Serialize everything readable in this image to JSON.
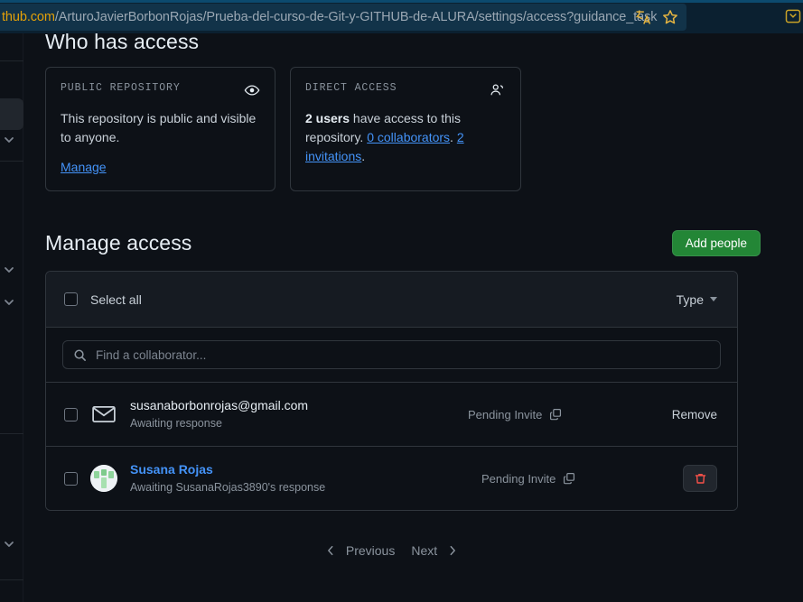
{
  "browser": {
    "url_host": "thub.com",
    "url_path": "/ArturoJavierBorbonRojas/Prueba-del-curso-de-Git-y-GITHUB-de-ALURA/settings/access?guidance_task",
    "translate_icon": "translate-icon",
    "star_icon": "star-icon",
    "edge_icon": "collections-icon"
  },
  "page": {
    "who_has_access_title": "Who has access",
    "manage_access_title": "Manage access"
  },
  "cards": {
    "public": {
      "label": "PUBLIC REPOSITORY",
      "icon": "eye-icon",
      "body": "This repository is public and visible to anyone.",
      "manage_link": "Manage"
    },
    "direct": {
      "label": "DIRECT ACCESS",
      "icon": "people-icon",
      "count": "2 users",
      "body_1": " have access to this repository. ",
      "link_collaborators": "0 collaborators",
      "sep": ". ",
      "link_invitations": "2 invitations",
      "period": "."
    }
  },
  "toolbar": {
    "add_people_label": "Add people",
    "add_people_color": "#238636"
  },
  "access_table": {
    "select_all_label": "Select all",
    "type_label": "Type",
    "search_placeholder": "Find a collaborator...",
    "search_value": "",
    "search_icon": "search-icon",
    "rows": [
      {
        "avatar_type": "mail",
        "name": "susanaborbonrojas@gmail.com",
        "name_is_link": false,
        "sub": "Awaiting response",
        "status": "Pending Invite",
        "action": "Remove",
        "action_type": "text"
      },
      {
        "avatar_type": "image",
        "name": "Susana Rojas",
        "name_is_link": true,
        "sub": "Awaiting SusanaRojas3890's response",
        "status": "Pending Invite",
        "action": "trash-icon",
        "action_type": "button"
      }
    ]
  },
  "pagination": {
    "previous": "Previous",
    "next": "Next",
    "prev_icon": "chevron-left-icon",
    "next_icon": "chevron-right-icon"
  }
}
